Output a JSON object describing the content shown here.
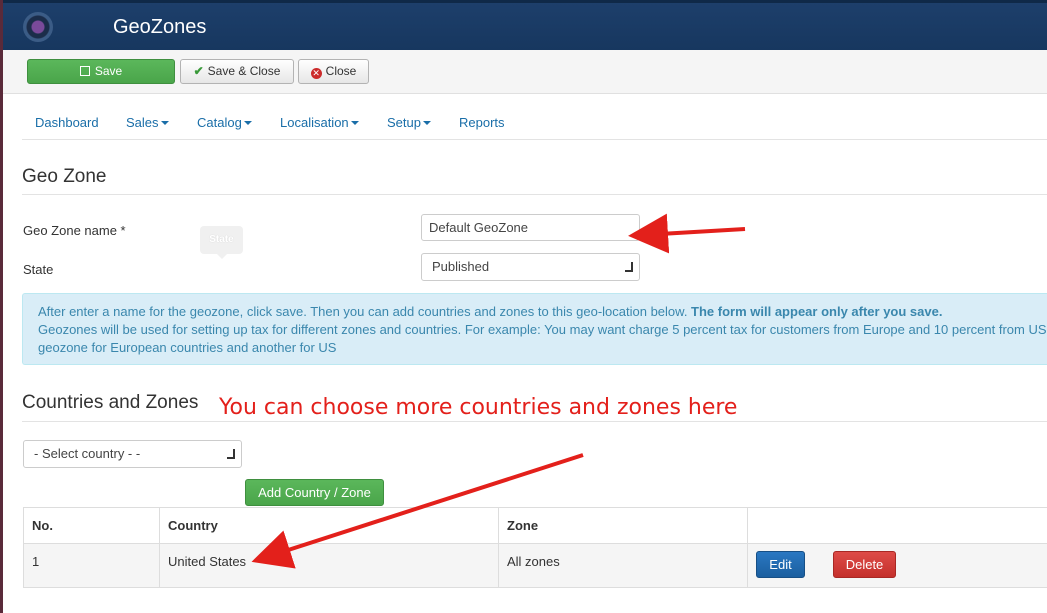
{
  "header": {
    "title": "GeoZones"
  },
  "toolbar": {
    "save_label": "Save",
    "save_close_label": "Save & Close",
    "close_label": "Close"
  },
  "nav": [
    {
      "label": "Dashboard",
      "dropdown": false
    },
    {
      "label": "Sales",
      "dropdown": true
    },
    {
      "label": "Catalog",
      "dropdown": true
    },
    {
      "label": "Localisation",
      "dropdown": true
    },
    {
      "label": "Setup",
      "dropdown": true
    },
    {
      "label": "Reports",
      "dropdown": false
    }
  ],
  "geo_zone": {
    "title": "Geo Zone",
    "name_label": "Geo Zone name *",
    "name_value": "Default GeoZone",
    "state_label": "State",
    "state_value": "Published",
    "tooltip": "State"
  },
  "info": {
    "line1": "After enter a name for the geozone, click save. Then you can add countries and zones to this geo-location below. ",
    "line1_bold": "The form will appear only after you save.",
    "line2": "Geozones will be used for setting up tax for different zones and countries. For example: You may want charge 5 percent tax for customers from Europe and 10 percent from US",
    "line3": "geozone for European countries and another for US"
  },
  "countries": {
    "title": "Countries and Zones",
    "annotation": "You can choose more countries and zones here",
    "select_value": "- Select country - -",
    "add_label": "Add Country / Zone",
    "columns": [
      "No.",
      "Country",
      "Zone",
      ""
    ],
    "rows": [
      {
        "no": "1",
        "country": "United States",
        "zone": "All zones"
      }
    ],
    "edit_label": "Edit",
    "delete_label": "Delete"
  },
  "colors": {
    "header": "#17375f",
    "primary_green": "#5bb75b",
    "link": "#1a6ea8",
    "annotation_red": "#e3201b"
  }
}
